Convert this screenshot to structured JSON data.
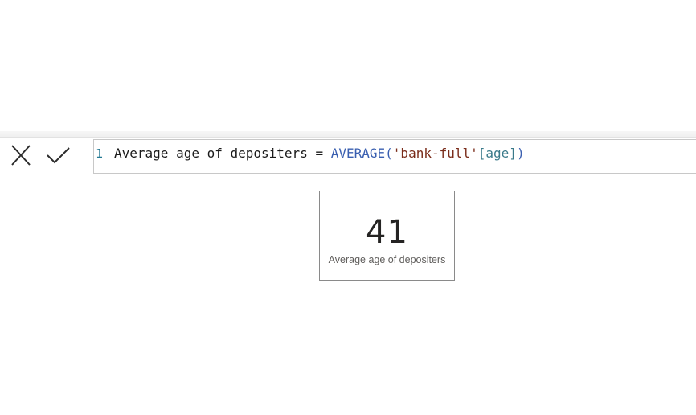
{
  "formula_bar": {
    "cancel_icon": "close-x-icon",
    "commit_icon": "checkmark-icon",
    "line_number": "1",
    "code_tokens": {
      "measure_part": "Average age of depositers = ",
      "function_name": "AVERAGE",
      "open_paren": "(",
      "table_name": "'bank-full'",
      "column_ref": "[age]",
      "close_paren": ")"
    }
  },
  "card": {
    "value": "41",
    "label": "Average age of depositers"
  },
  "colors": {
    "function": "#3a5fb0",
    "string": "#7a2c1a",
    "column": "#3a7a8a",
    "line_number": "#237893"
  }
}
